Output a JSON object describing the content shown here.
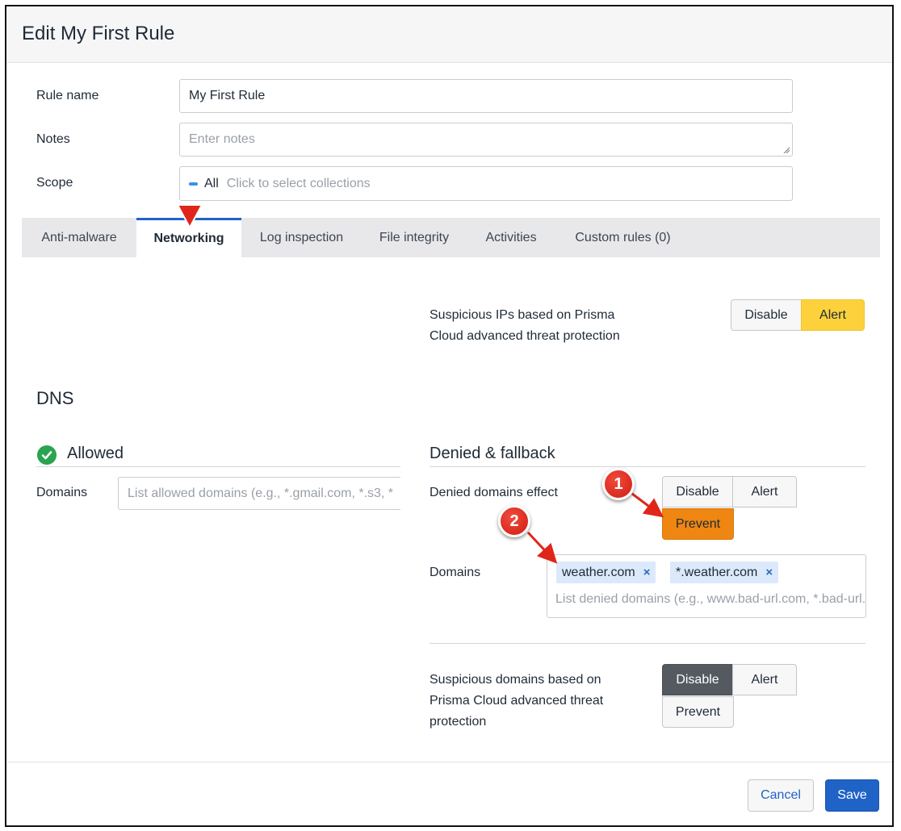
{
  "dialog": {
    "title": "Edit My First Rule"
  },
  "form": {
    "rule_name_label": "Rule name",
    "rule_name_value": "My First Rule",
    "notes_label": "Notes",
    "notes_placeholder": "Enter notes",
    "scope_label": "Scope",
    "scope_chip": "All",
    "scope_placeholder": "Click to select collections"
  },
  "tabs": [
    {
      "label": "Anti-malware",
      "active": false
    },
    {
      "label": "Networking",
      "active": true
    },
    {
      "label": "Log inspection",
      "active": false
    },
    {
      "label": "File integrity",
      "active": false
    },
    {
      "label": "Activities",
      "active": false
    },
    {
      "label": "Custom rules (0)",
      "active": false
    }
  ],
  "suspicious_ips": {
    "label_line1": "Suspicious IPs based on Prisma",
    "label_line2": "Cloud advanced threat protection",
    "buttons": [
      "Disable",
      "Alert"
    ],
    "selected": "Alert"
  },
  "dns": {
    "title": "DNS",
    "allowed": {
      "title": "Allowed",
      "domains_label": "Domains",
      "domains_placeholder": "List allowed domains (e.g., *.gmail.com, *.s3, *"
    },
    "denied": {
      "title": "Denied & fallback",
      "effect_label": "Denied domains effect",
      "effect_buttons": [
        "Disable",
        "Alert",
        "Prevent"
      ],
      "effect_selected": "Prevent",
      "domains_label": "Domains",
      "tags": [
        "weather.com",
        "*.weather.com"
      ],
      "tag_remove_symbol": "×",
      "domains_placeholder": "List denied domains (e.g., www.bad-url.com, *.bad-url.com)"
    },
    "suspicious_domains": {
      "label_line1": "Suspicious domains based on",
      "label_line2": "Prisma Cloud advanced threat",
      "label_line3": "protection",
      "buttons": [
        "Disable",
        "Alert",
        "Prevent"
      ],
      "selected": "Disable"
    }
  },
  "annotations": {
    "badge1": "1",
    "badge2": "2"
  },
  "footer": {
    "cancel": "Cancel",
    "save": "Save"
  },
  "icons": {
    "check": "check-circle-icon",
    "tab_pointer": "red-arrow-down-icon",
    "remove": "close-icon"
  },
  "colors": {
    "primary": "#1f63c6",
    "alert_active": "#fcd13c",
    "prevent_active": "#ee8611",
    "disable_active": "#555a61",
    "allowed_check": "#2aa44f",
    "annotation_red": "#e0261b",
    "tag_bg": "#dbe9fb"
  }
}
